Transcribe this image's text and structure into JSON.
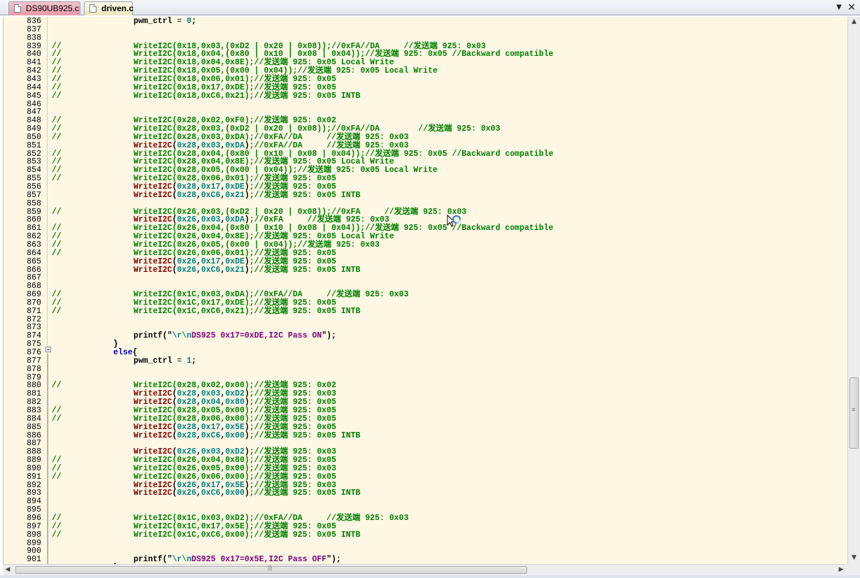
{
  "tabs": [
    {
      "label": "DS90UB925.c",
      "icon": "file-icon",
      "active": false
    },
    {
      "label": "driven.c",
      "icon": "file-icon",
      "active": true
    }
  ],
  "tabbar_icons": {
    "dropdown": "▼",
    "close": "✕"
  },
  "scroll_icons": {
    "up": "▲",
    "down": "▼",
    "left": "◀",
    "right": "▶"
  },
  "lines": [
    {
      "num": "836",
      "cmt": "",
      "segs": [
        {
          "c": "var",
          "t": "pwm_ctrl"
        },
        {
          "c": "blk",
          "t": " = "
        },
        {
          "c": "arg",
          "t": "0"
        },
        {
          "c": "pn",
          "t": ";"
        }
      ]
    },
    {
      "num": "837",
      "cmt": "",
      "segs": []
    },
    {
      "num": "838",
      "cmt": "",
      "segs": []
    },
    {
      "num": "839",
      "cmt": "//",
      "segs": [
        {
          "c": "",
          "t": "WriteI2C(0x18,0x03,(0xD2 | 0x20 | 0x08));//0xFA//DA     //发送端 925: 0x03"
        }
      ]
    },
    {
      "num": "840",
      "cmt": "//",
      "segs": [
        {
          "c": "",
          "t": "WriteI2C(0x18,0x04,(0x80 | 0x10 | 0x08 | 0x04));//发送端 925: 0x05 //Backward compatible"
        }
      ]
    },
    {
      "num": "841",
      "cmt": "//",
      "segs": [
        {
          "c": "",
          "t": "WriteI2C(0x18,0x04,0x8E);//发送端 925: 0x05 Local Write"
        }
      ]
    },
    {
      "num": "842",
      "cmt": "//",
      "segs": [
        {
          "c": "",
          "t": "WriteI2C(0x18,0x05,(0x00 | 0x04));//发送端 925: 0x05 Local Write"
        }
      ]
    },
    {
      "num": "843",
      "cmt": "//",
      "segs": [
        {
          "c": "",
          "t": "WriteI2C(0x18,0x06,0x01);//发送端 925: 0x05"
        }
      ]
    },
    {
      "num": "844",
      "cmt": "//",
      "segs": [
        {
          "c": "",
          "t": "WriteI2C(0x18,0x17,0xDE);//发送端 925: 0x05"
        }
      ]
    },
    {
      "num": "845",
      "cmt": "//",
      "segs": [
        {
          "c": "",
          "t": "WriteI2C(0x18,0xC6,0x21);//发送端 925: 0x05 INTB"
        }
      ]
    },
    {
      "num": "846",
      "cmt": "",
      "segs": []
    },
    {
      "num": "847",
      "cmt": "",
      "segs": []
    },
    {
      "num": "848",
      "cmt": "//",
      "segs": [
        {
          "c": "",
          "t": "WriteI2C(0x28,0x02,0xF0);//发送端 925: 0x02"
        }
      ]
    },
    {
      "num": "849",
      "cmt": "//",
      "segs": [
        {
          "c": "",
          "t": "WriteI2C(0x28,0x03,(0xD2 | 0x20 | 0x08));//0xFA//DA        //发送端 925: 0x03"
        }
      ]
    },
    {
      "num": "850",
      "cmt": "//",
      "segs": [
        {
          "c": "",
          "t": "WriteI2C(0x28,0x03,0xDA);//0xFA//DA     //发送端 925: 0x03"
        }
      ]
    },
    {
      "num": "851",
      "cmt": "",
      "segs": [
        {
          "c": "fn",
          "t": "WriteI2C"
        },
        {
          "c": "pn",
          "t": "("
        },
        {
          "c": "arg",
          "t": "0x28"
        },
        {
          "c": "pn",
          "t": ","
        },
        {
          "c": "arg",
          "t": "0x03"
        },
        {
          "c": "pn",
          "t": ","
        },
        {
          "c": "arg",
          "t": "0xDA"
        },
        {
          "c": "pn",
          "t": ")"
        },
        {
          "c": "",
          "t": ";//0xFA//DA     //发送端 925: 0x03"
        }
      ]
    },
    {
      "num": "852",
      "cmt": "//",
      "segs": [
        {
          "c": "",
          "t": "WriteI2C(0x28,0x04,(0x80 | 0x10 | 0x08 | 0x04));//发送端 925: 0x05 //Backward compatible"
        }
      ]
    },
    {
      "num": "853",
      "cmt": "//",
      "segs": [
        {
          "c": "",
          "t": "WriteI2C(0x28,0x04,0x8E);//发送端 925: 0x05 Local Write"
        }
      ]
    },
    {
      "num": "854",
      "cmt": "//",
      "segs": [
        {
          "c": "",
          "t": "WriteI2C(0x28,0x05,(0x00 | 0x04));//发送端 925: 0x05 Local Write"
        }
      ]
    },
    {
      "num": "855",
      "cmt": "//",
      "segs": [
        {
          "c": "",
          "t": "WriteI2C(0x28,0x06,0x01);//发送端 925: 0x05"
        }
      ]
    },
    {
      "num": "856",
      "cmt": "",
      "segs": [
        {
          "c": "fn",
          "t": "WriteI2C"
        },
        {
          "c": "pn",
          "t": "("
        },
        {
          "c": "arg",
          "t": "0x28"
        },
        {
          "c": "pn",
          "t": ","
        },
        {
          "c": "arg",
          "t": "0x17"
        },
        {
          "c": "pn",
          "t": ","
        },
        {
          "c": "arg",
          "t": "0xDE"
        },
        {
          "c": "pn",
          "t": ")"
        },
        {
          "c": "",
          "t": ";//发送端 925: 0x05"
        }
      ]
    },
    {
      "num": "857",
      "cmt": "",
      "segs": [
        {
          "c": "fn",
          "t": "WriteI2C"
        },
        {
          "c": "pn",
          "t": "("
        },
        {
          "c": "arg",
          "t": "0x28"
        },
        {
          "c": "pn",
          "t": ","
        },
        {
          "c": "arg",
          "t": "0xC6"
        },
        {
          "c": "pn",
          "t": ","
        },
        {
          "c": "arg",
          "t": "0x21"
        },
        {
          "c": "pn",
          "t": ")"
        },
        {
          "c": "",
          "t": ";//发送端 925: 0x05 INTB"
        }
      ]
    },
    {
      "num": "858",
      "cmt": "",
      "segs": []
    },
    {
      "num": "859",
      "cmt": "//",
      "segs": [
        {
          "c": "",
          "t": "WriteI2C(0x26,0x03,(0xD2 | 0x20 | 0x08));//0xFA     //发送端 925: 0x03"
        }
      ]
    },
    {
      "num": "860",
      "cmt": "",
      "segs": [
        {
          "c": "fn",
          "t": "WriteI2C"
        },
        {
          "c": "pn",
          "t": "("
        },
        {
          "c": "arg",
          "t": "0x26"
        },
        {
          "c": "pn",
          "t": ","
        },
        {
          "c": "arg",
          "t": "0x03"
        },
        {
          "c": "pn",
          "t": ","
        },
        {
          "c": "arg",
          "t": "0xDA"
        },
        {
          "c": "pn",
          "t": ")"
        },
        {
          "c": "",
          "t": ";//0xFA     //发送端 925: 0x03"
        }
      ]
    },
    {
      "num": "861",
      "cmt": "//",
      "segs": [
        {
          "c": "",
          "t": "WriteI2C(0x26,0x04,(0x80 | 0x10 | 0x08 | 0x04));//发送端 925: 0x05 //Backward compatible"
        }
      ]
    },
    {
      "num": "862",
      "cmt": "//",
      "segs": [
        {
          "c": "",
          "t": "WriteI2C(0x26,0x04,0x8E);//发送端 925: 0x05 Local Write"
        }
      ]
    },
    {
      "num": "863",
      "cmt": "//",
      "segs": [
        {
          "c": "",
          "t": "WriteI2C(0x26,0x05,(0x00 | 0x04));//发送端 925: 0x03"
        }
      ]
    },
    {
      "num": "864",
      "cmt": "//",
      "segs": [
        {
          "c": "",
          "t": "WriteI2C(0x26,0x06,0x01);//发送端 925: 0x05"
        }
      ]
    },
    {
      "num": "865",
      "cmt": "",
      "segs": [
        {
          "c": "fn",
          "t": "WriteI2C"
        },
        {
          "c": "pn",
          "t": "("
        },
        {
          "c": "arg",
          "t": "0x26"
        },
        {
          "c": "pn",
          "t": ","
        },
        {
          "c": "arg",
          "t": "0x17"
        },
        {
          "c": "pn",
          "t": ","
        },
        {
          "c": "arg",
          "t": "0xDE"
        },
        {
          "c": "pn",
          "t": ")"
        },
        {
          "c": "",
          "t": ";//发送端 925: 0x05"
        }
      ]
    },
    {
      "num": "866",
      "cmt": "",
      "segs": [
        {
          "c": "fn",
          "t": "WriteI2C"
        },
        {
          "c": "pn",
          "t": "("
        },
        {
          "c": "arg",
          "t": "0x26"
        },
        {
          "c": "pn",
          "t": ","
        },
        {
          "c": "arg",
          "t": "0xC6"
        },
        {
          "c": "pn",
          "t": ","
        },
        {
          "c": "arg",
          "t": "0x21"
        },
        {
          "c": "pn",
          "t": ")"
        },
        {
          "c": "",
          "t": ";//发送端 925: 0x05 INTB"
        }
      ]
    },
    {
      "num": "867",
      "cmt": "",
      "segs": []
    },
    {
      "num": "868",
      "cmt": "",
      "segs": []
    },
    {
      "num": "869",
      "cmt": "//",
      "segs": [
        {
          "c": "",
          "t": "WriteI2C(0x1C,0x03,0xDA);//0xFA//DA     //发送端 925: 0x03"
        }
      ]
    },
    {
      "num": "870",
      "cmt": "//",
      "segs": [
        {
          "c": "",
          "t": "WriteI2C(0x1C,0x17,0xDE);//发送端 925: 0x05"
        }
      ]
    },
    {
      "num": "871",
      "cmt": "//",
      "segs": [
        {
          "c": "",
          "t": "WriteI2C(0x1C,0xC6,0x21);//发送端 925: 0x05 INTB"
        }
      ]
    },
    {
      "num": "872",
      "cmt": "",
      "segs": []
    },
    {
      "num": "873",
      "cmt": "",
      "segs": []
    },
    {
      "num": "874",
      "cmt": "",
      "segs": [
        {
          "c": "var",
          "t": "printf"
        },
        {
          "c": "pn",
          "t": "(\""
        },
        {
          "c": "esc",
          "t": "\\r\\n"
        },
        {
          "c": "str",
          "t": "DS925 0x17=0xDE,I2C Pass ON"
        },
        {
          "c": "pn",
          "t": "\");"
        }
      ]
    },
    {
      "num": "875",
      "cmt": "",
      "indent": "back",
      "segs": [
        {
          "c": "pn",
          "t": "}"
        }
      ]
    },
    {
      "num": "876",
      "cmt": "",
      "indent": "back",
      "segs": [
        {
          "c": "kw",
          "t": "else"
        },
        {
          "c": "pn",
          "t": "{"
        }
      ]
    },
    {
      "num": "877",
      "cmt": "",
      "segs": [
        {
          "c": "var",
          "t": "pwm_ctrl"
        },
        {
          "c": "blk",
          "t": " = "
        },
        {
          "c": "arg",
          "t": "1"
        },
        {
          "c": "pn",
          "t": ";"
        }
      ]
    },
    {
      "num": "878",
      "cmt": "",
      "segs": []
    },
    {
      "num": "879",
      "cmt": "",
      "segs": []
    },
    {
      "num": "880",
      "cmt": "//",
      "segs": [
        {
          "c": "",
          "t": "WriteI2C(0x28,0x02,0x00);//发送端 925: 0x02"
        }
      ]
    },
    {
      "num": "881",
      "cmt": "",
      "segs": [
        {
          "c": "fn",
          "t": "WriteI2C"
        },
        {
          "c": "pn",
          "t": "("
        },
        {
          "c": "arg",
          "t": "0x28"
        },
        {
          "c": "pn",
          "t": ","
        },
        {
          "c": "arg",
          "t": "0x03"
        },
        {
          "c": "pn",
          "t": ","
        },
        {
          "c": "arg",
          "t": "0xD2"
        },
        {
          "c": "pn",
          "t": ")"
        },
        {
          "c": "",
          "t": ";//发送端 925: 0x03"
        }
      ]
    },
    {
      "num": "882",
      "cmt": "",
      "segs": [
        {
          "c": "fn",
          "t": "WriteI2C"
        },
        {
          "c": "pn",
          "t": "("
        },
        {
          "c": "arg",
          "t": "0x28"
        },
        {
          "c": "pn",
          "t": ","
        },
        {
          "c": "arg",
          "t": "0x04"
        },
        {
          "c": "pn",
          "t": ","
        },
        {
          "c": "arg",
          "t": "0x80"
        },
        {
          "c": "pn",
          "t": ")"
        },
        {
          "c": "",
          "t": ";//发送端 925: 0x05"
        }
      ]
    },
    {
      "num": "883",
      "cmt": "//",
      "segs": [
        {
          "c": "",
          "t": "WriteI2C(0x28,0x05,0x00);//发送端 925: 0x05"
        }
      ]
    },
    {
      "num": "884",
      "cmt": "//",
      "segs": [
        {
          "c": "",
          "t": "WriteI2C(0x28,0x06,0x00);//发送端 925: 0x05"
        }
      ]
    },
    {
      "num": "885",
      "cmt": "",
      "segs": [
        {
          "c": "fn",
          "t": "WriteI2C"
        },
        {
          "c": "pn",
          "t": "("
        },
        {
          "c": "arg",
          "t": "0x28"
        },
        {
          "c": "pn",
          "t": ","
        },
        {
          "c": "arg",
          "t": "0x17"
        },
        {
          "c": "pn",
          "t": ","
        },
        {
          "c": "arg",
          "t": "0x5E"
        },
        {
          "c": "pn",
          "t": ")"
        },
        {
          "c": "",
          "t": ";//发送端 925: 0x05"
        }
      ]
    },
    {
      "num": "886",
      "cmt": "",
      "segs": [
        {
          "c": "fn",
          "t": "WriteI2C"
        },
        {
          "c": "pn",
          "t": "("
        },
        {
          "c": "arg",
          "t": "0x28"
        },
        {
          "c": "pn",
          "t": ","
        },
        {
          "c": "arg",
          "t": "0xC6"
        },
        {
          "c": "pn",
          "t": ","
        },
        {
          "c": "arg",
          "t": "0x00"
        },
        {
          "c": "pn",
          "t": ")"
        },
        {
          "c": "",
          "t": ";//发送端 925: 0x05 INTB"
        }
      ]
    },
    {
      "num": "887",
      "cmt": "",
      "segs": []
    },
    {
      "num": "888",
      "cmt": "",
      "segs": [
        {
          "c": "fn",
          "t": "WriteI2C"
        },
        {
          "c": "pn",
          "t": "("
        },
        {
          "c": "arg",
          "t": "0x26"
        },
        {
          "c": "pn",
          "t": ","
        },
        {
          "c": "arg",
          "t": "0x03"
        },
        {
          "c": "pn",
          "t": ","
        },
        {
          "c": "arg",
          "t": "0xD2"
        },
        {
          "c": "pn",
          "t": ")"
        },
        {
          "c": "",
          "t": ";//发送端 925: 0x03"
        }
      ]
    },
    {
      "num": "889",
      "cmt": "//",
      "segs": [
        {
          "c": "",
          "t": "WriteI2C(0x26,0x04,0x80);//发送端 925: 0x05"
        }
      ]
    },
    {
      "num": "890",
      "cmt": "//",
      "segs": [
        {
          "c": "",
          "t": "WriteI2C(0x26,0x05,0x00);//发送端 925: 0x03"
        }
      ]
    },
    {
      "num": "891",
      "cmt": "//",
      "segs": [
        {
          "c": "",
          "t": "WriteI2C(0x26,0x06,0x00);//发送端 925: 0x05"
        }
      ]
    },
    {
      "num": "892",
      "cmt": "",
      "segs": [
        {
          "c": "fn",
          "t": "WriteI2C"
        },
        {
          "c": "pn",
          "t": "("
        },
        {
          "c": "arg",
          "t": "0x26"
        },
        {
          "c": "pn",
          "t": ","
        },
        {
          "c": "arg",
          "t": "0x17"
        },
        {
          "c": "pn",
          "t": ","
        },
        {
          "c": "arg",
          "t": "0x5E"
        },
        {
          "c": "pn",
          "t": ")"
        },
        {
          "c": "",
          "t": ";//发送端 925: 0x03"
        }
      ]
    },
    {
      "num": "893",
      "cmt": "",
      "segs": [
        {
          "c": "fn",
          "t": "WriteI2C"
        },
        {
          "c": "pn",
          "t": "("
        },
        {
          "c": "arg",
          "t": "0x26"
        },
        {
          "c": "pn",
          "t": ","
        },
        {
          "c": "arg",
          "t": "0xC6"
        },
        {
          "c": "pn",
          "t": ","
        },
        {
          "c": "arg",
          "t": "0x00"
        },
        {
          "c": "pn",
          "t": ")"
        },
        {
          "c": "",
          "t": ";//发送端 925: 0x05 INTB"
        }
      ]
    },
    {
      "num": "894",
      "cmt": "",
      "segs": []
    },
    {
      "num": "895",
      "cmt": "",
      "segs": []
    },
    {
      "num": "896",
      "cmt": "//",
      "segs": [
        {
          "c": "",
          "t": "WriteI2C(0x1C,0x03,0xD2);//0xFA//DA     //发送端 925: 0x03"
        }
      ]
    },
    {
      "num": "897",
      "cmt": "//",
      "segs": [
        {
          "c": "",
          "t": "WriteI2C(0x1C,0x17,0x5E);//发送端 925: 0x05"
        }
      ]
    },
    {
      "num": "898",
      "cmt": "//",
      "segs": [
        {
          "c": "",
          "t": "WriteI2C(0x1C,0xC6,0x00);//发送端 925: 0x05 INTB"
        }
      ]
    },
    {
      "num": "899",
      "cmt": "",
      "segs": []
    },
    {
      "num": "900",
      "cmt": "",
      "segs": []
    },
    {
      "num": "901",
      "cmt": "",
      "segs": [
        {
          "c": "var",
          "t": "printf"
        },
        {
          "c": "pn",
          "t": "(\""
        },
        {
          "c": "esc",
          "t": "\\r\\n"
        },
        {
          "c": "str",
          "t": "DS925 0x17=0x5E,I2C Pass OFF"
        },
        {
          "c": "pn",
          "t": "\");"
        }
      ]
    },
    {
      "num": "902",
      "cmt": "",
      "indent": "back",
      "segs": [
        {
          "c": "pn",
          "t": "}"
        }
      ]
    }
  ]
}
